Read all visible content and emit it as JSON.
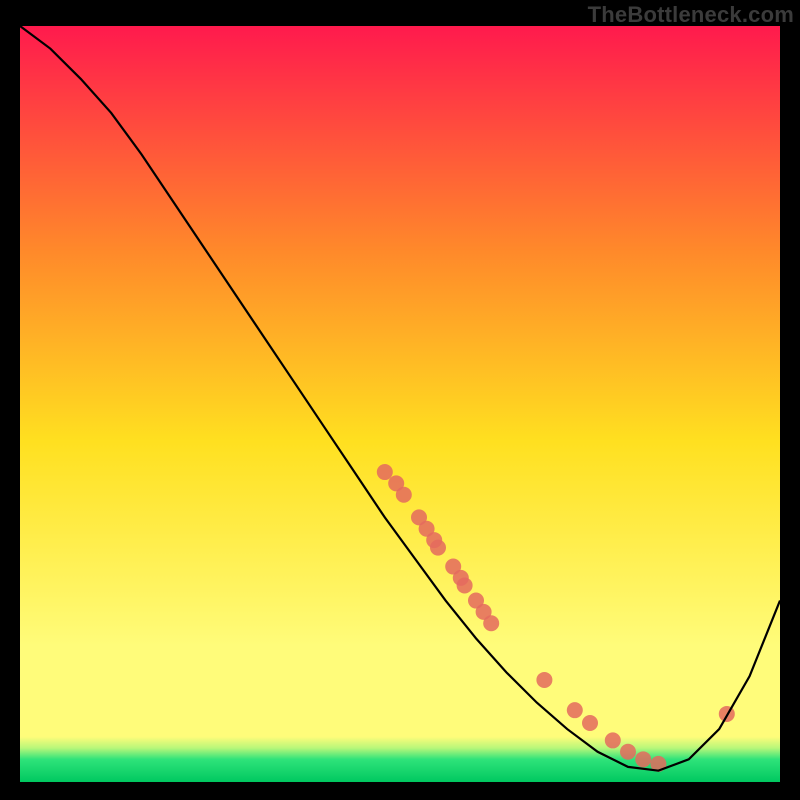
{
  "watermark": "TheBottleneck.com",
  "chart_data": {
    "type": "line",
    "title": "",
    "xlabel": "",
    "ylabel": "",
    "xlim": [
      0,
      100
    ],
    "ylim": [
      0,
      100
    ],
    "grid": false,
    "background_gradient": {
      "top": "#ff1a4d",
      "mid1": "#ff8a2a",
      "mid2": "#ffe020",
      "mid3": "#fffc7a",
      "bottom_band": "#2fe37a",
      "bottom": "#00c860"
    },
    "series": [
      {
        "name": "curve",
        "type": "line",
        "x": [
          0,
          4,
          8,
          12,
          16,
          20,
          24,
          28,
          32,
          36,
          40,
          44,
          48,
          52,
          56,
          60,
          64,
          68,
          72,
          76,
          80,
          84,
          88,
          92,
          96,
          100
        ],
        "y": [
          100,
          97,
          93,
          88.5,
          83,
          77,
          71,
          65,
          59,
          53,
          47,
          41,
          35,
          29.5,
          24,
          19,
          14.5,
          10.5,
          7,
          4,
          2,
          1.5,
          3,
          7,
          14,
          24
        ]
      },
      {
        "name": "dots",
        "type": "scatter",
        "x": [
          48,
          49.5,
          50.5,
          52.5,
          53.5,
          54.5,
          55,
          57,
          58,
          58.5,
          60,
          61,
          62,
          69,
          73,
          75,
          78,
          80,
          82,
          84,
          93
        ],
        "y": [
          41,
          39.5,
          38,
          35,
          33.5,
          32,
          31,
          28.5,
          27,
          26,
          24,
          22.5,
          21,
          13.5,
          9.5,
          7.8,
          5.5,
          4,
          3,
          2.4,
          9
        ]
      }
    ],
    "dot_color": "#e46a5e",
    "line_color": "#000000"
  }
}
